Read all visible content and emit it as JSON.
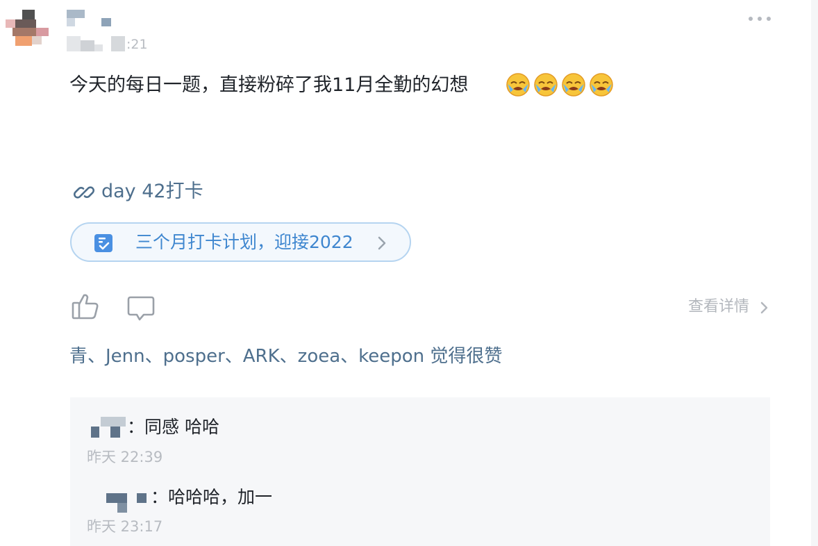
{
  "post": {
    "time_suffix": ":21",
    "text": "今天的每日一题，直接粉碎了我11月全勤的幻想",
    "emojis": [
      "face-holding-back-tears-emoji",
      "face-holding-back-tears-emoji",
      "face-holding-back-tears-emoji",
      "face-holding-back-tears-emoji"
    ]
  },
  "link": {
    "label": "day 42打卡"
  },
  "plan": {
    "label": "三个月打卡计划，迎接2022"
  },
  "actions": {
    "detail_label": "查看详情"
  },
  "likes": {
    "text": "青、Jenn、posper、ARK、zoea、keepon 觉得很赞"
  },
  "comments": [
    {
      "text": "：同感 哈哈",
      "time": "昨天 22:39"
    },
    {
      "text": "：哈哈哈，加一",
      "time": "昨天 23:17"
    }
  ],
  "colors": {
    "accent_blue": "#3e86cf",
    "link_blue": "#4e6f8d",
    "muted": "#b3b7bd"
  }
}
